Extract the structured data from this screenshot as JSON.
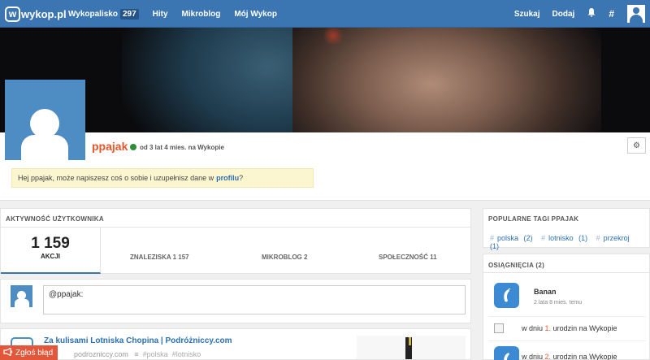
{
  "nav": {
    "logo": "wykop.pl",
    "logo_mark": "w",
    "items": [
      {
        "label": "Wykopalisko",
        "badge": "297"
      },
      {
        "label": "Hity"
      },
      {
        "label": "Mikroblog"
      },
      {
        "label": "Mój Wykop"
      }
    ],
    "search_label": "Szukaj",
    "add_label": "Dodaj",
    "bell_icon": "bell-icon",
    "hash_icon": "#"
  },
  "profile": {
    "username": "ppajak",
    "since": "od 3 lat 4 mies. na Wykopie",
    "settings_icon": "⚙",
    "hint_text": "Hej ppajak, może napiszesz coś o sobie i uzupełnisz dane w",
    "hint_link": "profilu",
    "hint_suffix": "?"
  },
  "activity": {
    "title": "AKTYWNOŚĆ UŻYTKOWNIKA",
    "total": "1 159",
    "total_label": "AKCJI",
    "tabs": [
      {
        "label": "ZNALEZISKA 1 157"
      },
      {
        "label": "MIKROBLOG 2"
      },
      {
        "label": "SPOŁECZNOŚĆ 11"
      }
    ]
  },
  "comment": {
    "value": "@ppajak:"
  },
  "link_item": {
    "title": "Za kulisami Lotniska Chopina | Podróżniccy.com",
    "domain": "podrozniccy.com",
    "sep": "≡",
    "tags": [
      "#polska",
      "#lotnisko"
    ]
  },
  "report": {
    "label": "Zgłoś błąd"
  },
  "popular_tags": {
    "title": "POPULARNE TAGI PPAJAK",
    "items": [
      {
        "tag": "polska",
        "count": "(2)"
      },
      {
        "tag": "lotnisko",
        "count": "(1)"
      },
      {
        "tag": "przekroj",
        "count": "(1)"
      }
    ]
  },
  "achievements": {
    "title": "OSIĄGNIĘCIA (2)",
    "first_name": "Banan",
    "first_time": "2 lata 8 mies. temu",
    "bday1_prefix": "w dniu",
    "bday1_num": "1.",
    "bday1_suffix": "urodzin na Wykopie",
    "bday2_prefix": "w dniu",
    "bday2_num": "2.",
    "bday2_suffix": "urodzin na Wykopie"
  },
  "colors": {
    "nav": "#3b76b3",
    "accent_orange": "#e9562a",
    "link_blue": "#2c6fb1",
    "report_red": "#e2573a"
  }
}
